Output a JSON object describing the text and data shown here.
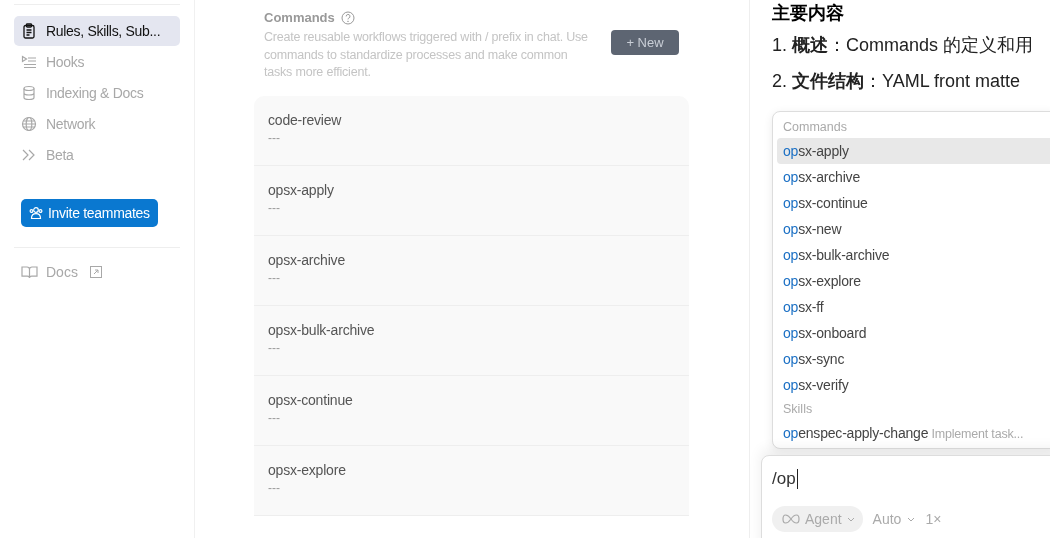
{
  "sidebar": {
    "items": [
      {
        "label": "Rules, Skills, Sub...",
        "selected": true
      },
      {
        "label": "Hooks",
        "selected": false
      },
      {
        "label": "Indexing & Docs",
        "selected": false
      },
      {
        "label": "Network",
        "selected": false
      },
      {
        "label": "Beta",
        "selected": false
      }
    ],
    "invite_button": "Invite teammates",
    "docs_link": "Docs"
  },
  "commands": {
    "title": "Commands",
    "description": "Create reusable workflows triggered with / prefix in chat. Use commands to standardize processes and make common tasks more efficient.",
    "new_button": "+ New",
    "rows": [
      {
        "name": "code-review",
        "detail": "---"
      },
      {
        "name": "opsx-apply",
        "detail": "---"
      },
      {
        "name": "opsx-archive",
        "detail": "---"
      },
      {
        "name": "opsx-bulk-archive",
        "detail": "---"
      },
      {
        "name": "opsx-continue",
        "detail": "---"
      },
      {
        "name": "opsx-explore",
        "detail": "---"
      }
    ]
  },
  "chat": {
    "heading": "主要内容",
    "lines": [
      "1. **概述**：Commands 的定义和用",
      "2. **文件结构**：YAML front matte"
    ],
    "popup": {
      "sections": [
        {
          "title": "Commands",
          "items": [
            {
              "match": "op",
              "rest": "sx-apply",
              "selected": true
            },
            {
              "match": "op",
              "rest": "sx-archive",
              "selected": false
            },
            {
              "match": "op",
              "rest": "sx-continue",
              "selected": false
            },
            {
              "match": "op",
              "rest": "sx-new",
              "selected": false
            },
            {
              "match": "op",
              "rest": "sx-bulk-archive",
              "selected": false
            },
            {
              "match": "op",
              "rest": "sx-explore",
              "selected": false
            },
            {
              "match": "op",
              "rest": "sx-ff",
              "selected": false
            },
            {
              "match": "op",
              "rest": "sx-onboard",
              "selected": false
            },
            {
              "match": "op",
              "rest": "sx-sync",
              "selected": false
            },
            {
              "match": "op",
              "rest": "sx-verify",
              "selected": false
            }
          ]
        },
        {
          "title": "Skills",
          "items": [
            {
              "match": "op",
              "rest": "enspec-apply-change",
              "hint": "Implement task...",
              "selected": false
            }
          ]
        }
      ]
    },
    "input": {
      "value": "/op",
      "mode": "Agent",
      "model": "Auto",
      "speed": "1×"
    }
  }
}
